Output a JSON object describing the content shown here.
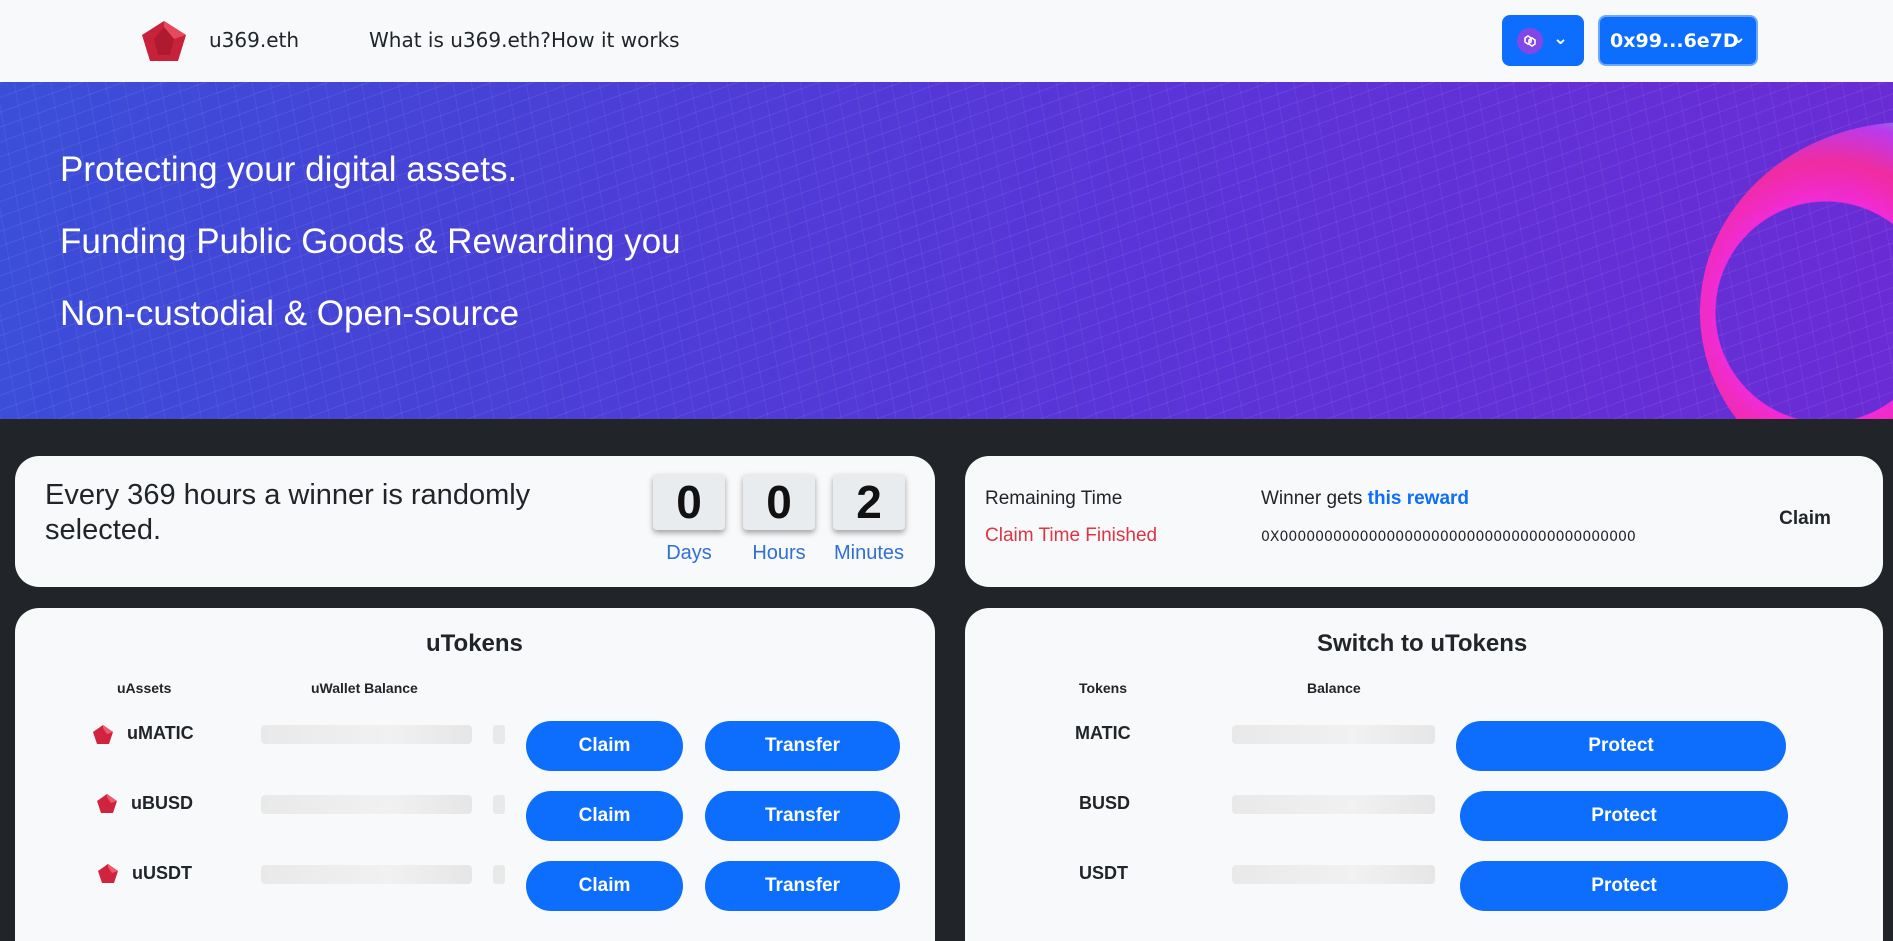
{
  "nav": {
    "brand": "u369.eth",
    "links": [
      "What is u369.eth?",
      "How it works"
    ],
    "network_icon": "polygon-icon",
    "account": "0x99...6e7D"
  },
  "hero": {
    "lines": [
      "Protecting your digital assets.",
      "Funding Public Goods & Rewarding you",
      "Non-custodial & Open-source"
    ]
  },
  "lottery": {
    "text": "Every 369 hours a winner is randomly selected.",
    "countdown": [
      {
        "value": "0",
        "label": "Days"
      },
      {
        "value": "0",
        "label": "Hours"
      },
      {
        "value": "2",
        "label": "Minutes"
      }
    ]
  },
  "winner": {
    "remaining_label": "Remaining Time",
    "remaining_status": "Claim Time Finished",
    "winner_prefix": "Winner gets",
    "winner_link": "this reward",
    "address": "0X0000000000000000000000000000000000000000",
    "claim_label": "Claim"
  },
  "utokens": {
    "title": "uTokens",
    "col_assets": "uAssets",
    "col_balance": "uWallet Balance",
    "rows": [
      {
        "name": "uMATIC",
        "claim": "Claim",
        "transfer": "Transfer"
      },
      {
        "name": "uBUSD",
        "claim": "Claim",
        "transfer": "Transfer"
      },
      {
        "name": "uUSDT",
        "claim": "Claim",
        "transfer": "Transfer"
      }
    ]
  },
  "switch": {
    "title": "Switch to uTokens",
    "col_tokens": "Tokens",
    "col_balance": "Balance",
    "rows": [
      {
        "name": "MATIC",
        "protect": "Protect"
      },
      {
        "name": "BUSD",
        "protect": "Protect"
      },
      {
        "name": "USDT",
        "protect": "Protect"
      }
    ]
  },
  "colors": {
    "primary": "#0d6efd",
    "danger": "#dc3545",
    "dark_bg": "#212529",
    "card_bg": "#f8f9fa",
    "gem": "#d0243e"
  }
}
